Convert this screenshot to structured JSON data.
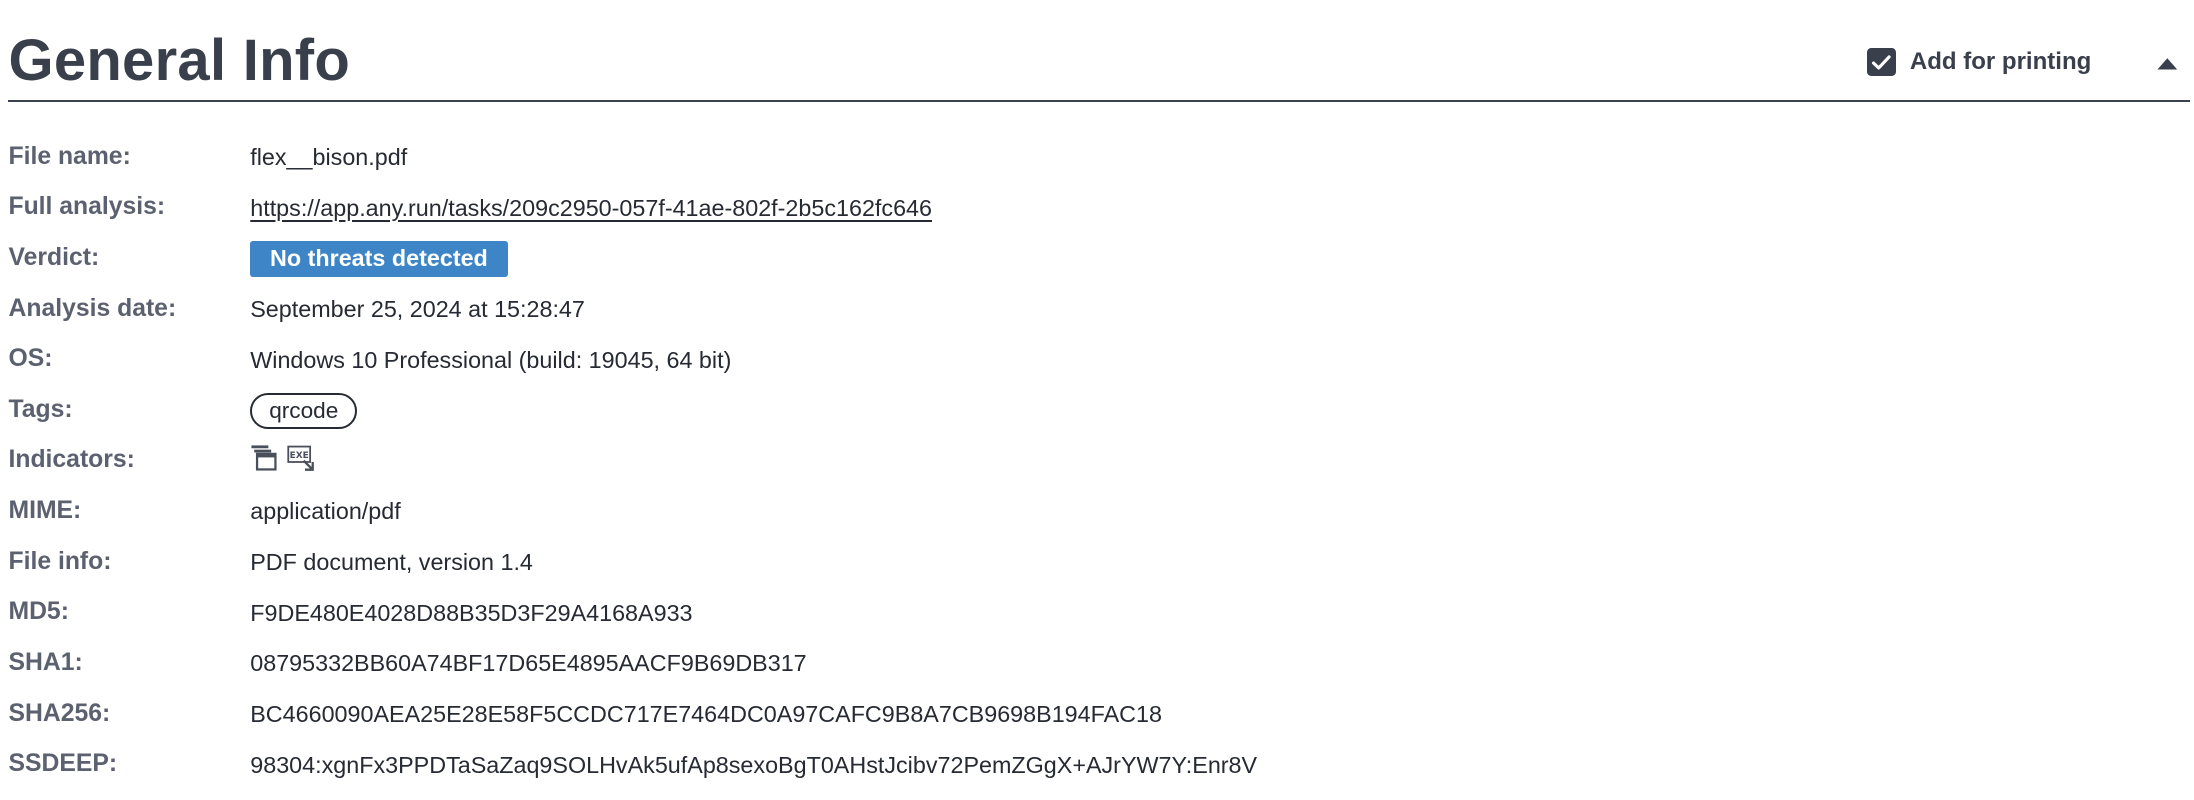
{
  "header": {
    "title": "General Info",
    "print_label": "Add for printing",
    "print_checked": true
  },
  "rows": {
    "file_name": {
      "label": "File name:",
      "value": "flex__bison.pdf"
    },
    "full_analysis": {
      "label": "Full analysis:",
      "value": "https://app.any.run/tasks/209c2950-057f-41ae-802f-2b5c162fc646"
    },
    "verdict": {
      "label": "Verdict:",
      "value": "No threats detected"
    },
    "analysis_date": {
      "label": "Analysis date:",
      "value": "September 25, 2024 at 15:28:47"
    },
    "os": {
      "label": "OS:",
      "value": "Windows 10 Professional (build: 19045, 64 bit)"
    },
    "tags": {
      "label": "Tags:",
      "value": "qrcode"
    },
    "indicators": {
      "label": "Indicators:",
      "icons": [
        "multiple-windows-icon",
        "exe-file-icon"
      ]
    },
    "mime": {
      "label": "MIME:",
      "value": "application/pdf"
    },
    "file_info": {
      "label": "File info:",
      "value": "PDF document, version 1.4"
    },
    "md5": {
      "label": "MD5:",
      "value": "F9DE480E4028D88B35D3F29A4168A933"
    },
    "sha1": {
      "label": "SHA1:",
      "value": "08795332BB60A74BF17D65E4895AACF9B69DB317"
    },
    "sha256": {
      "label": "SHA256:",
      "value": "BC4660090AEA25E28E58F5CCDC717E7464DC0A97CAFC9B8A7CB9698B194FAC18"
    },
    "ssdeep": {
      "label": "SSDEEP:",
      "value": "98304:xgnFx3PPDTaSaZaq9SOLHvAk5ufAp8sexoBgT0AHstJcibv72PemZGgX+AJrYW7Y:Enr8V"
    }
  },
  "colors": {
    "heading": "#3a3f4c",
    "label": "#5c6170",
    "verdict_badge": "#3d85c6"
  }
}
